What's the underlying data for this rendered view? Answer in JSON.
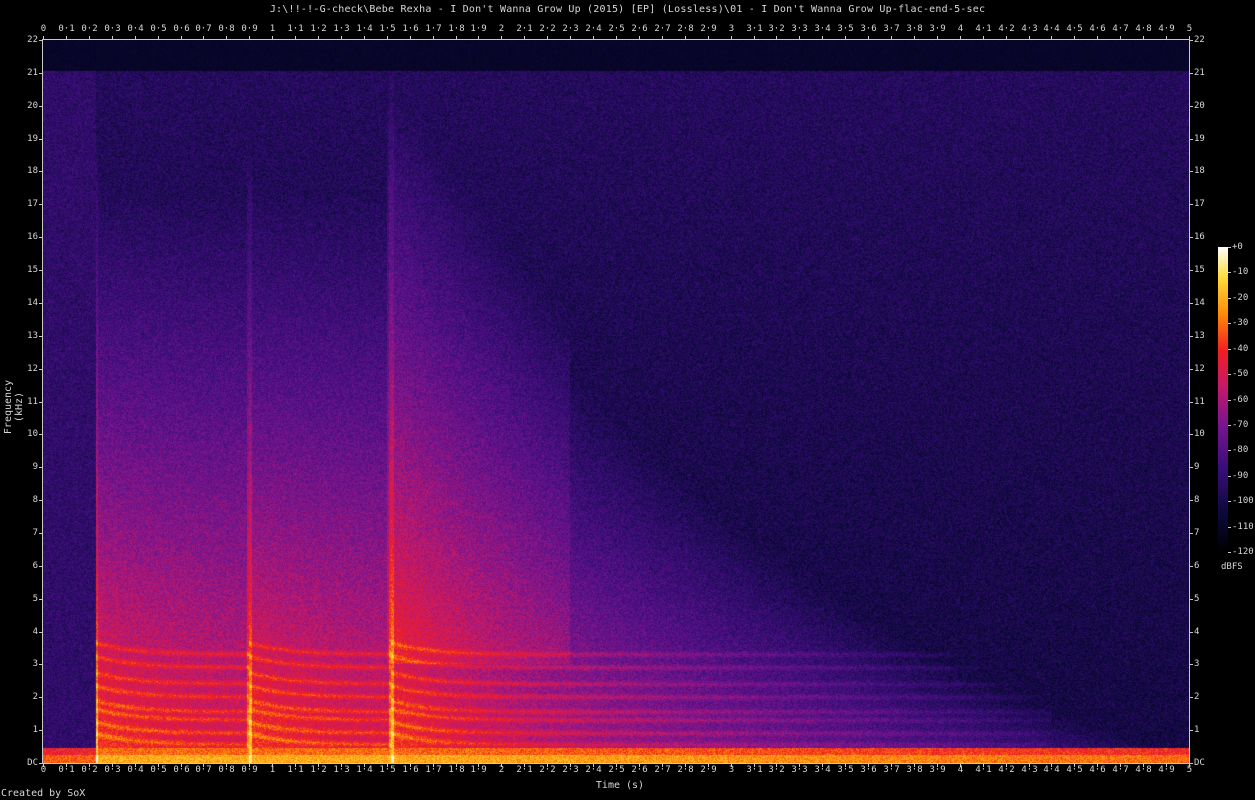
{
  "title": "J:\\!!-!-G-check\\Bebe Rexha - I Don't Wanna Grow Up (2015) [EP] (Lossless)\\01 - I Don't Wanna Grow Up-flac-end-5-sec",
  "credit": "Created by SoX",
  "chart_data": {
    "type": "heatmap",
    "title": "J:\\!!-!-G-check\\Bebe Rexha - I Don't Wanna Grow Up (2015) [EP] (Lossless)\\01 - I Don't Wanna Grow Up-flac-end-5-sec",
    "xlabel": "Time (s)",
    "ylabel": "Frequency (kHz)",
    "xlim": [
      0,
      5
    ],
    "ylim": [
      0,
      22
    ],
    "x_ticks": [
      "0",
      "0·1",
      "0·2",
      "0·3",
      "0·4",
      "0·5",
      "0·6",
      "0·7",
      "0·8",
      "0·9",
      "1",
      "1·1",
      "1·2",
      "1·3",
      "1·4",
      "1·5",
      "1·6",
      "1·7",
      "1·8",
      "1·9",
      "2",
      "2·1",
      "2·2",
      "2·3",
      "2·4",
      "2·5",
      "2·6",
      "2·7",
      "2·8",
      "2·9",
      "3",
      "3·1",
      "3·2",
      "3·3",
      "3·4",
      "3·5",
      "3·6",
      "3·7",
      "3·8",
      "3·9",
      "4",
      "4·1",
      "4·2",
      "4·3",
      "4·4",
      "4·5",
      "4·6",
      "4·7",
      "4·8",
      "4·9",
      "5"
    ],
    "y_ticks": [
      "DC",
      "1",
      "2",
      "3",
      "4",
      "5",
      "6",
      "7",
      "8",
      "9",
      "10",
      "11",
      "12",
      "13",
      "14",
      "15",
      "16",
      "17",
      "18",
      "19",
      "20",
      "21",
      "22"
    ],
    "colorbar": {
      "label": "dBFS",
      "ticks": [
        "+0",
        "-10",
        "-20",
        "-30",
        "-40",
        "-50",
        "-60",
        "-70",
        "-80",
        "-90",
        "-100",
        "-110",
        "-120"
      ],
      "range": [
        -120,
        0
      ]
    },
    "lowpass_cutoff_khz": 21,
    "onsets_s": [
      0.23,
      0.9,
      1.52
    ],
    "decay_end_s": 4.4
  }
}
